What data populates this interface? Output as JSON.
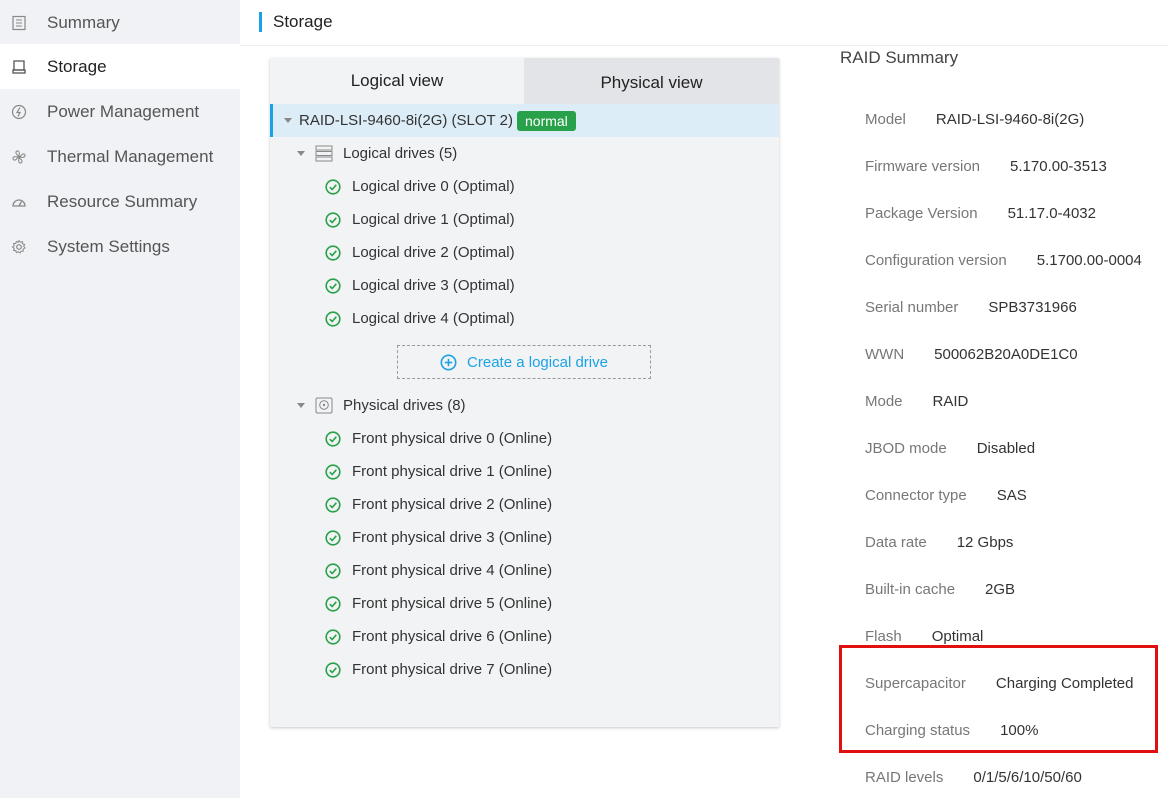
{
  "sidebar": {
    "items": [
      {
        "label": "Summary",
        "icon": "list-icon"
      },
      {
        "label": "Storage",
        "icon": "drive-icon",
        "active": true
      },
      {
        "label": "Power Management",
        "icon": "power-icon"
      },
      {
        "label": "Thermal Management",
        "icon": "fan-icon"
      },
      {
        "label": "Resource Summary",
        "icon": "gauge-icon"
      },
      {
        "label": "System Settings",
        "icon": "gear-icon"
      }
    ]
  },
  "header": {
    "title": "Storage"
  },
  "tabs": {
    "logical": "Logical view",
    "physical": "Physical view"
  },
  "tree": {
    "controller": {
      "label": "RAID-LSI-9460-8i(2G) (SLOT 2)",
      "status": "normal"
    },
    "logical_group": {
      "label": "Logical drives (5)"
    },
    "logical_drives": [
      "Logical drive 0 (Optimal)",
      "Logical drive 1 (Optimal)",
      "Logical drive 2 (Optimal)",
      "Logical drive 3 (Optimal)",
      "Logical drive 4 (Optimal)"
    ],
    "create_button": "Create a logical drive",
    "physical_group": {
      "label": "Physical drives (8)"
    },
    "physical_drives": [
      "Front physical drive 0 (Online)",
      "Front physical drive 1 (Online)",
      "Front physical drive 2 (Online)",
      "Front physical drive 3 (Online)",
      "Front physical drive 4 (Online)",
      "Front physical drive 5 (Online)",
      "Front physical drive 6 (Online)",
      "Front physical drive 7 (Online)"
    ]
  },
  "details": {
    "title": "RAID Summary",
    "rows": [
      {
        "label": "Model",
        "value": "RAID-LSI-9460-8i(2G)"
      },
      {
        "label": "Firmware version",
        "value": "5.170.00-3513"
      },
      {
        "label": "Package Version",
        "value": "51.17.0-4032"
      },
      {
        "label": "Configuration version",
        "value": "5.1700.00-0004"
      },
      {
        "label": "Serial number",
        "value": "SPB3731966"
      },
      {
        "label": "WWN",
        "value": "500062B20A0DE1C0"
      },
      {
        "label": "Mode",
        "value": "RAID"
      },
      {
        "label": "JBOD mode",
        "value": "Disabled"
      },
      {
        "label": "Connector type",
        "value": "SAS"
      },
      {
        "label": "Data rate",
        "value": "12 Gbps"
      },
      {
        "label": "Built-in cache",
        "value": "2GB"
      },
      {
        "label": "Flash",
        "value": "Optimal"
      },
      {
        "label": "Supercapacitor",
        "value": "Charging Completed"
      },
      {
        "label": "Charging status",
        "value": "100%"
      },
      {
        "label": "RAID levels",
        "value": "0/1/5/6/10/50/60"
      }
    ]
  },
  "colors": {
    "accent": "#1aa2e6",
    "success": "#29a14a",
    "highlight": "#e01010"
  }
}
